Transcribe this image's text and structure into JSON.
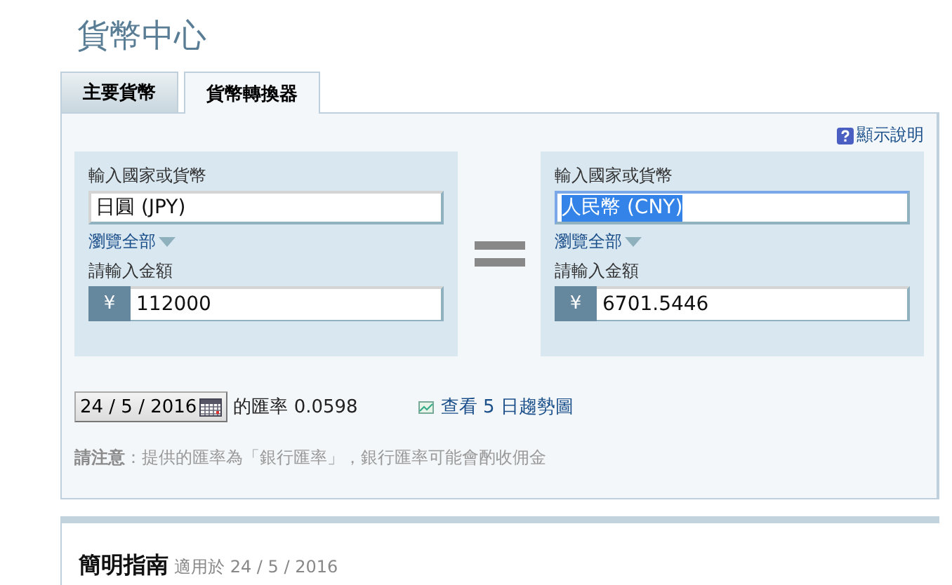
{
  "title": "貨幣中心",
  "tabs": [
    {
      "label": "主要貨幣",
      "selected": false
    },
    {
      "label": "貨幣轉換器",
      "selected": true
    }
  ],
  "help_link": "顯示說明",
  "converter": [
    {
      "currency_label": "輸入國家或貨幣",
      "currency_value": "日圓 (JPY)",
      "text_highlighted": false,
      "browse_link": "瀏覽全部",
      "amount_label": "請輸入金額",
      "symbol": "¥",
      "amount_value": "112000"
    },
    {
      "currency_label": "輸入國家或貨幣",
      "currency_value": "人民幣 (CNY)",
      "text_highlighted": true,
      "browse_link": "瀏覽全部",
      "amount_label": "請輸入金額",
      "symbol": "¥",
      "amount_value": "6701.5446"
    }
  ],
  "date": "24 / 5 / 2016",
  "rate_text": "的匯率 0.0598",
  "trend_link": "查看 5 日趨勢圖",
  "note": "**請注意**：提供的匯率為「銀行匯率」，銀行匯率可能會酌收佣金",
  "guide": {
    "title": "簡明指南",
    "subtitle": "適用於 24 / 5 / 2016"
  }
}
